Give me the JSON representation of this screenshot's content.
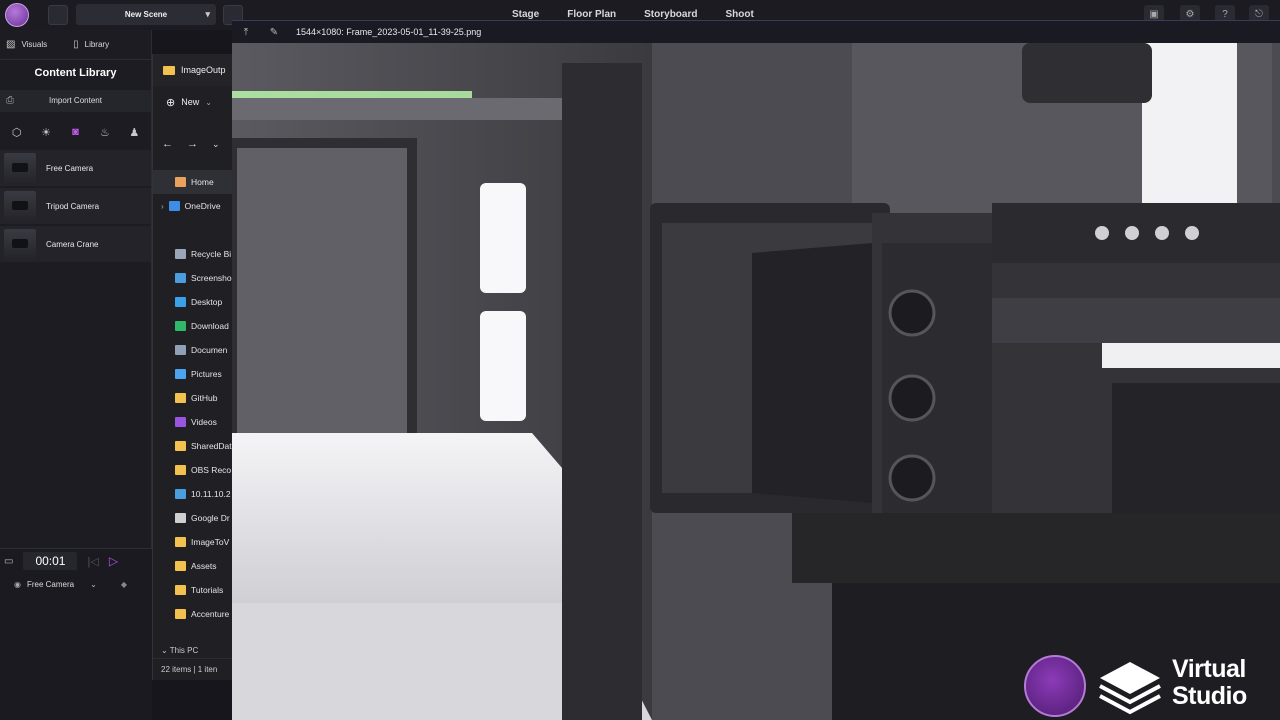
{
  "topbar": {
    "scene_name": "New Scene",
    "modes": [
      "Stage",
      "Floor Plan",
      "Storyboard",
      "Shoot"
    ]
  },
  "left_panel": {
    "tabs": [
      {
        "label": "Visuals",
        "icon": "image-icon"
      },
      {
        "label": "Library",
        "icon": "book-icon"
      }
    ],
    "title": "Content Library",
    "import_label": "Import Content",
    "filters": [
      "cube-icon",
      "light-icon",
      "camera-icon",
      "fire-icon",
      "character-icon"
    ],
    "active_filter": "camera-icon",
    "items": [
      {
        "label": "Free Camera"
      },
      {
        "label": "Tripod Camera"
      },
      {
        "label": "Camera Crane"
      }
    ],
    "timeline": {
      "time": "00:01",
      "track_label": "Free Camera"
    }
  },
  "explorer": {
    "folder": "ImageOutp",
    "new_label": "New",
    "items": [
      {
        "label": "Home",
        "icon_color": "#e8a25a",
        "selected": true
      },
      {
        "label": "OneDrive",
        "icon_color": "#3c8ee8"
      },
      {
        "label": "Recycle Bi",
        "icon_color": "#9aa7b8"
      },
      {
        "label": "Screensho",
        "icon_color": "#4a9ee0"
      },
      {
        "label": "Desktop",
        "icon_color": "#3aa0e8"
      },
      {
        "label": "Download",
        "icon_color": "#2fb86a"
      },
      {
        "label": "Documen",
        "icon_color": "#8fa0b8"
      },
      {
        "label": "Pictures",
        "icon_color": "#4aa4f0"
      },
      {
        "label": "GitHub",
        "icon_color": "#f2c14e"
      },
      {
        "label": "Videos",
        "icon_color": "#9a54e0"
      },
      {
        "label": "SharedDat",
        "icon_color": "#f2c14e"
      },
      {
        "label": "OBS Reco",
        "icon_color": "#f2c14e"
      },
      {
        "label": "10.11.10.2",
        "icon_color": "#4a9ee0"
      },
      {
        "label": "Google Dr",
        "icon_color": "#cfcfcf"
      },
      {
        "label": "ImageToV",
        "icon_color": "#f2c14e"
      },
      {
        "label": "Assets",
        "icon_color": "#f2c14e"
      },
      {
        "label": "Tutorials",
        "icon_color": "#f2c14e"
      },
      {
        "label": "Accenture",
        "icon_color": "#f2c14e"
      }
    ],
    "this_pc": "This PC",
    "status": "22 items  |  1 iten"
  },
  "viewer": {
    "title": "1544×1080: Frame_2023-05-01_11-39-25.png"
  },
  "watermark": {
    "line1": "Virtual",
    "line2": "Studio"
  },
  "colors": {
    "accent": "#b553e9",
    "panel": "#1c1c22",
    "folder": "#f2c14e"
  }
}
